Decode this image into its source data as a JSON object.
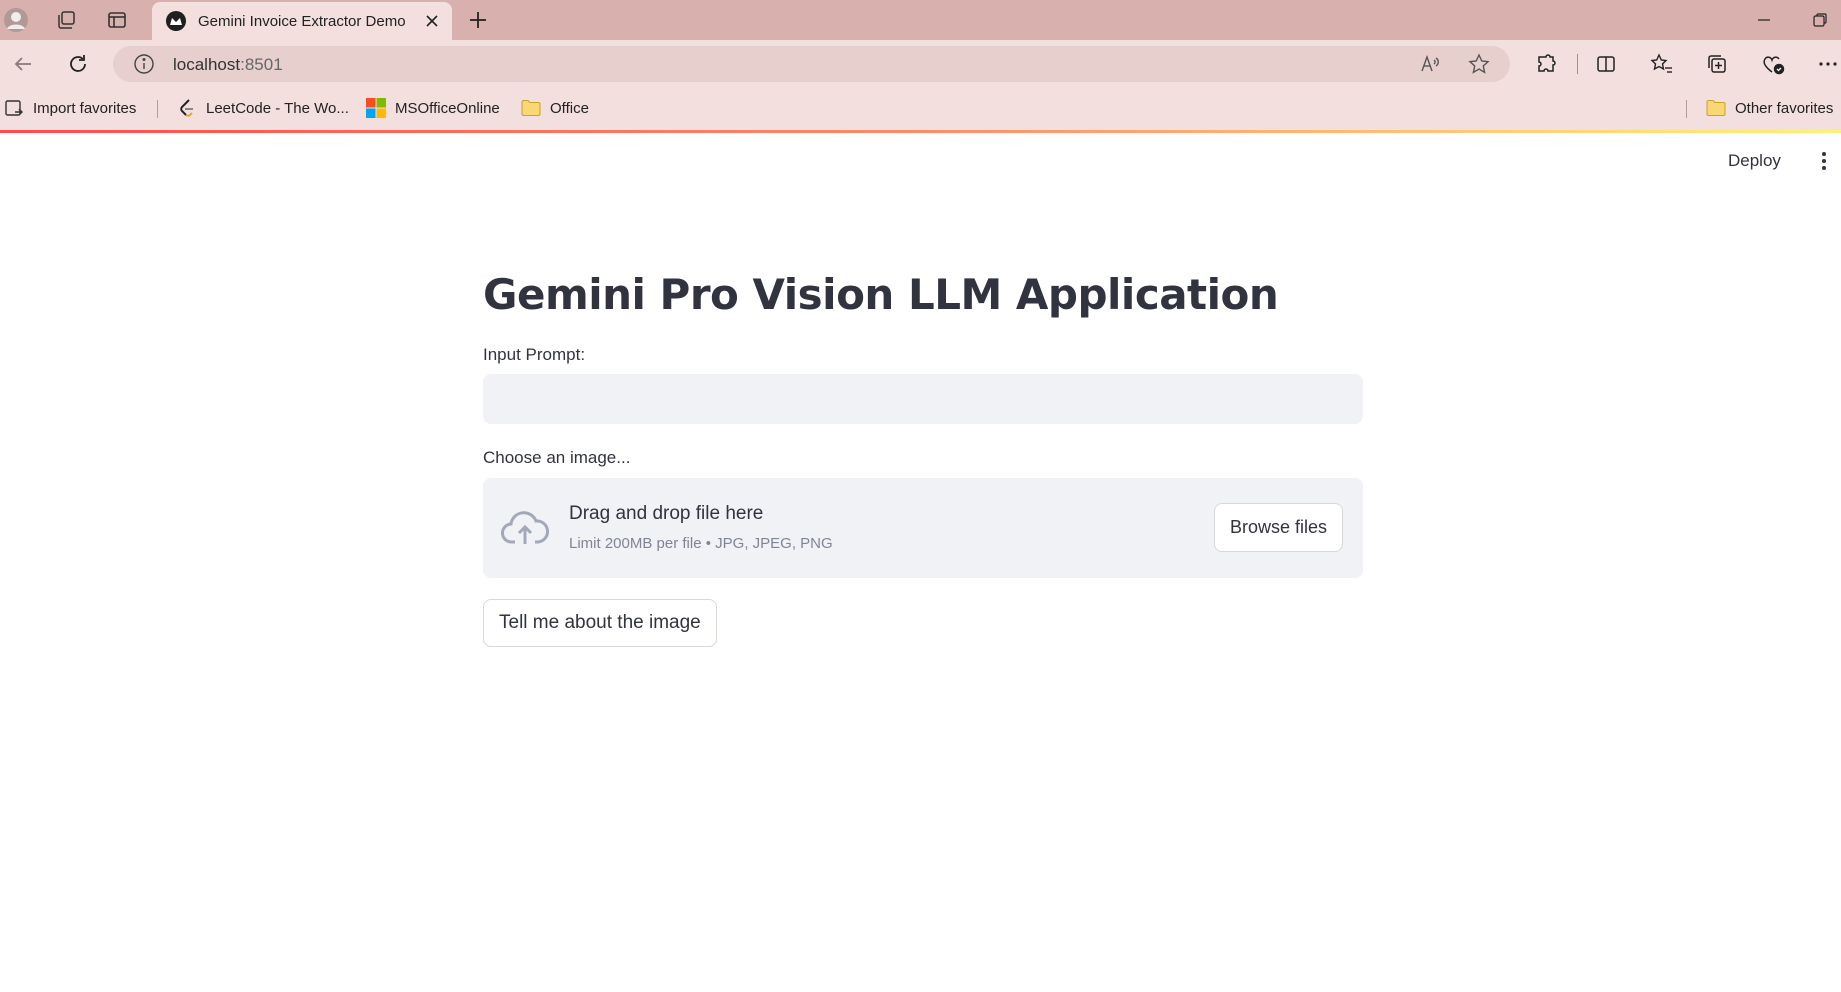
{
  "browser": {
    "tab_title": "Gemini Invoice Extractor Demo",
    "url_host": "localhost",
    "url_port": ":8501",
    "favorites": [
      {
        "label": "Import favorites",
        "icon": "import-icon"
      },
      {
        "label": "LeetCode - The Wo...",
        "icon": "leetcode-icon"
      },
      {
        "label": "MSOfficeOnline",
        "icon": "microsoft-icon"
      },
      {
        "label": "Office",
        "icon": "folder-icon"
      }
    ],
    "other_favorites": "Other favorites",
    "colors": {
      "tabbar": "#d8b0ad",
      "toolbar": "#f3dfde"
    }
  },
  "app": {
    "deploy_label": "Deploy",
    "title": "Gemini Pro Vision LLM Application",
    "input_label": "Input Prompt:",
    "input_value": "",
    "uploader_label": "Choose an image...",
    "dropzone_main": "Drag and drop file here",
    "dropzone_sub": "Limit 200MB per file • JPG, JPEG, PNG",
    "browse_label": "Browse files",
    "submit_label": "Tell me about the image",
    "colors": {
      "text": "#31333f",
      "input_bg": "#f0f2f6",
      "accent": "#ff4b4b"
    }
  }
}
